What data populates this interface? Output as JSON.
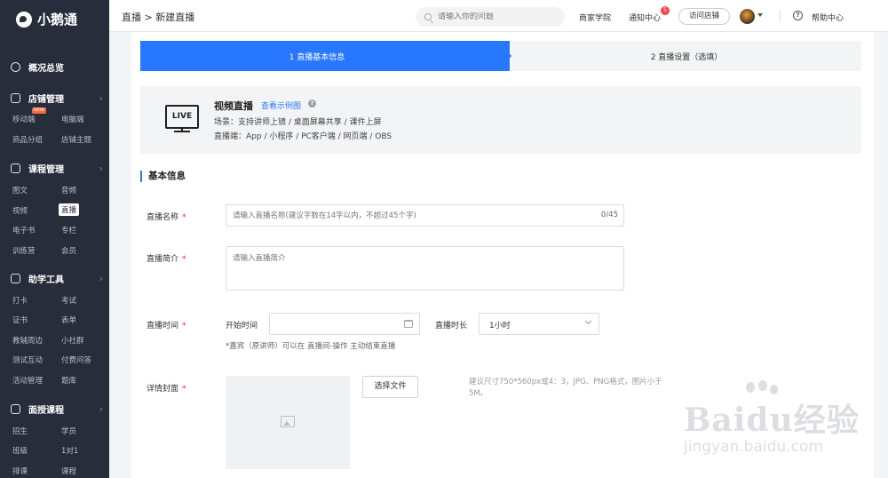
{
  "brand": {
    "name": "小鹅通"
  },
  "sidebar": {
    "overview": "概况总览",
    "groups": [
      {
        "title": "店铺管理",
        "items": [
          "移动端",
          "电脑端",
          "商品分组",
          "店铺主题"
        ],
        "badge": "NEW"
      },
      {
        "title": "课程管理",
        "items": [
          "图文",
          "音频",
          "视频",
          "直播",
          "电子书",
          "专栏",
          "训练营",
          "会员"
        ],
        "active": "直播"
      },
      {
        "title": "助学工具",
        "items": [
          "打卡",
          "考试",
          "证书",
          "表单",
          "教辅周边",
          "小社群",
          "测试互动",
          "付费问答",
          "活动管理",
          "题库"
        ]
      },
      {
        "title": "面授课程",
        "items": [
          "招生",
          "学员",
          "班级",
          "1对1",
          "排课",
          "课程"
        ]
      }
    ]
  },
  "topbar": {
    "breadcrumb": "直播 > 新建直播",
    "search_placeholder": "请输入你的问题",
    "merchant_school": "商家学院",
    "notifications": "通知中心",
    "notification_count": "5",
    "visit_store": "访问店铺",
    "help": "帮助中心"
  },
  "steps": {
    "step1": "1 直播基本信息",
    "step2": "2 直播设置（选填）"
  },
  "live_info": {
    "tv_label": "LIVE",
    "title": "视频直播",
    "example_link": "查看示例图",
    "scenes": "场景：支持讲师上镜 / 桌面屏幕共享 / 课件上屏",
    "clients": "直播端：App / 小程序 / PC客户端 / 网页端 / OBS"
  },
  "form": {
    "section_title": "基本信息",
    "name_label": "直播名称",
    "name_placeholder": "请输入直播名称(建议字数在14字以内，不超过45个字)",
    "name_counter": "0/45",
    "intro_label": "直播简介",
    "intro_placeholder": "请输入直播简介",
    "time_label": "直播时间",
    "start_time_label": "开始时间",
    "duration_label": "直播时长",
    "duration_value": "1小时",
    "time_hint": "*嘉宾（原讲师）可以在 直播间-操作 主动结束直播",
    "cover_label": "详情封面",
    "choose_file": "选择文件",
    "cover_hint": "建议尺寸750*560px或4：3，JPG、PNG格式，图片小于5M。",
    "required_mark": "*"
  },
  "watermark": {
    "main": "Baidu经验",
    "sub": "jingyan.baidu.com"
  }
}
